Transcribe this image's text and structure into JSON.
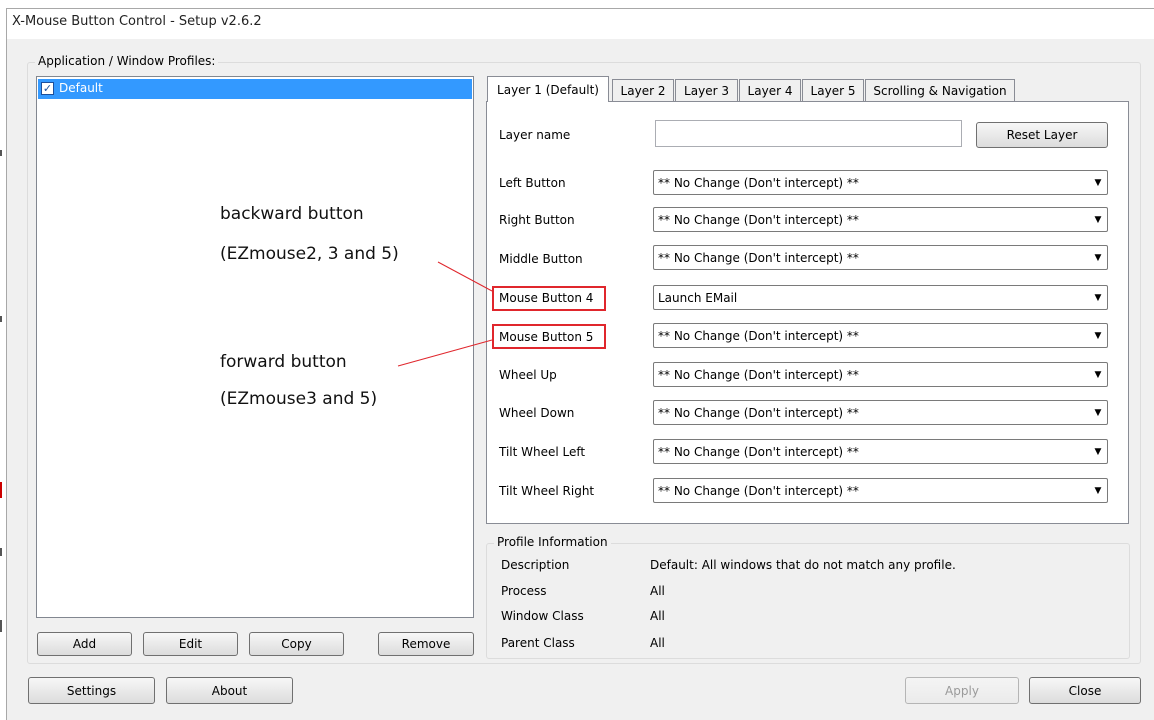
{
  "window": {
    "title": "X-Mouse Button Control - Setup v2.6.2"
  },
  "profiles": {
    "group_label": "Application / Window Profiles:",
    "items": [
      {
        "label": "Default",
        "checked": true,
        "selected": true
      }
    ],
    "buttons": {
      "add": "Add",
      "edit": "Edit",
      "copy": "Copy",
      "remove": "Remove"
    }
  },
  "tabs": [
    {
      "label": "Layer 1 (Default)",
      "active": true
    },
    {
      "label": "Layer 2"
    },
    {
      "label": "Layer 3"
    },
    {
      "label": "Layer 4"
    },
    {
      "label": "Layer 5"
    },
    {
      "label": "Scrolling & Navigation"
    }
  ],
  "layer": {
    "name_label": "Layer name",
    "name_value": "",
    "reset_button": "Reset Layer",
    "rows": [
      {
        "label": "Left Button",
        "value": "** No Change (Don't intercept) **"
      },
      {
        "label": "Right Button",
        "value": "** No Change (Don't intercept) **"
      },
      {
        "label": "Middle Button",
        "value": "** No Change (Don't intercept) **"
      },
      {
        "label": "Mouse Button 4",
        "value": "Launch EMail",
        "highlighted": true
      },
      {
        "label": "Mouse Button 5",
        "value": "** No Change (Don't intercept) **",
        "highlighted": true
      },
      {
        "label": "Wheel Up",
        "value": "** No Change (Don't intercept) **"
      },
      {
        "label": "Wheel Down",
        "value": "** No Change (Don't intercept) **"
      },
      {
        "label": "Tilt Wheel Left",
        "value": "** No Change (Don't intercept) **"
      },
      {
        "label": "Tilt Wheel Right",
        "value": "** No Change (Don't intercept) **"
      }
    ]
  },
  "profile_info": {
    "group_label": "Profile Information",
    "rows": [
      {
        "label": "Description",
        "value": "Default: All windows that do not match any profile."
      },
      {
        "label": "Process",
        "value": "All"
      },
      {
        "label": "Window Class",
        "value": "All"
      },
      {
        "label": "Parent Class",
        "value": "All"
      }
    ]
  },
  "annotations": {
    "backward": {
      "line1": "backward button",
      "line2": "(EZmouse2, 3 and 5)"
    },
    "forward": {
      "line1": "forward button",
      "line2": "(EZmouse3 and 5)"
    },
    "color": "#e0262c"
  },
  "footer": {
    "settings": "Settings",
    "about": "About",
    "apply": "Apply",
    "close": "Close"
  },
  "icons": {
    "checkbox": "check-mark",
    "dropdown": "triangle-down"
  }
}
